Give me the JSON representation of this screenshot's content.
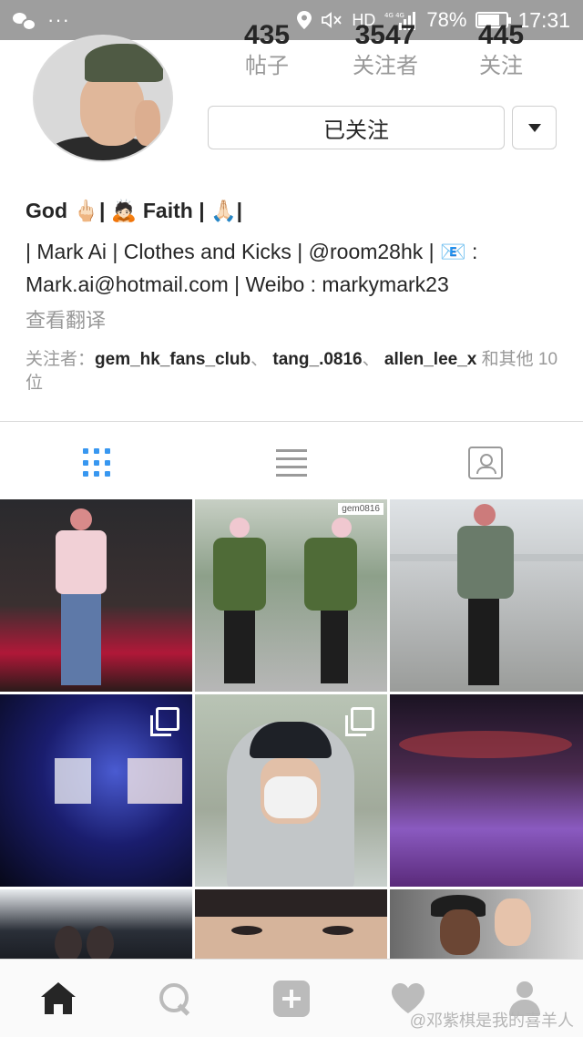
{
  "status_bar": {
    "dots": "···",
    "network": "HD",
    "network_sub": "4G 4G",
    "battery": "78%",
    "battery_level": 0.78,
    "time": "17:31"
  },
  "profile": {
    "stats": [
      {
        "value": "435",
        "label": "帖子"
      },
      {
        "value": "3547",
        "label": "关注者"
      },
      {
        "value": "445",
        "label": "关注"
      }
    ],
    "follow_button": "已关注",
    "name": "God 🖕🏻| 🙇🏻 Faith | 🙏🏻|",
    "bio_line1": "| Mark Ai | Clothes and Kicks | @room28hk | 📧 :",
    "bio_line2": "Mark.ai@hotmail.com | Weibo : markymark23",
    "translate": "查看翻译",
    "followed_by_prefix": "关注者：",
    "followed_by": [
      "gem_hk_fans_club",
      "tang_.0816",
      "allen_lee_x"
    ],
    "followed_by_sep": "、",
    "followed_by_suffix": "和其他 10 位"
  },
  "tabs": [
    "grid-view",
    "list-view",
    "tagged-view"
  ],
  "grid_badge": "gem0816",
  "nav": [
    "home",
    "search",
    "add",
    "activity",
    "profile"
  ],
  "watermark": "@邓紫棋是我的喜羊人",
  "colors": {
    "accent": "#3897f0",
    "status_bar": "#9e9e9e",
    "muted": "#999999"
  }
}
